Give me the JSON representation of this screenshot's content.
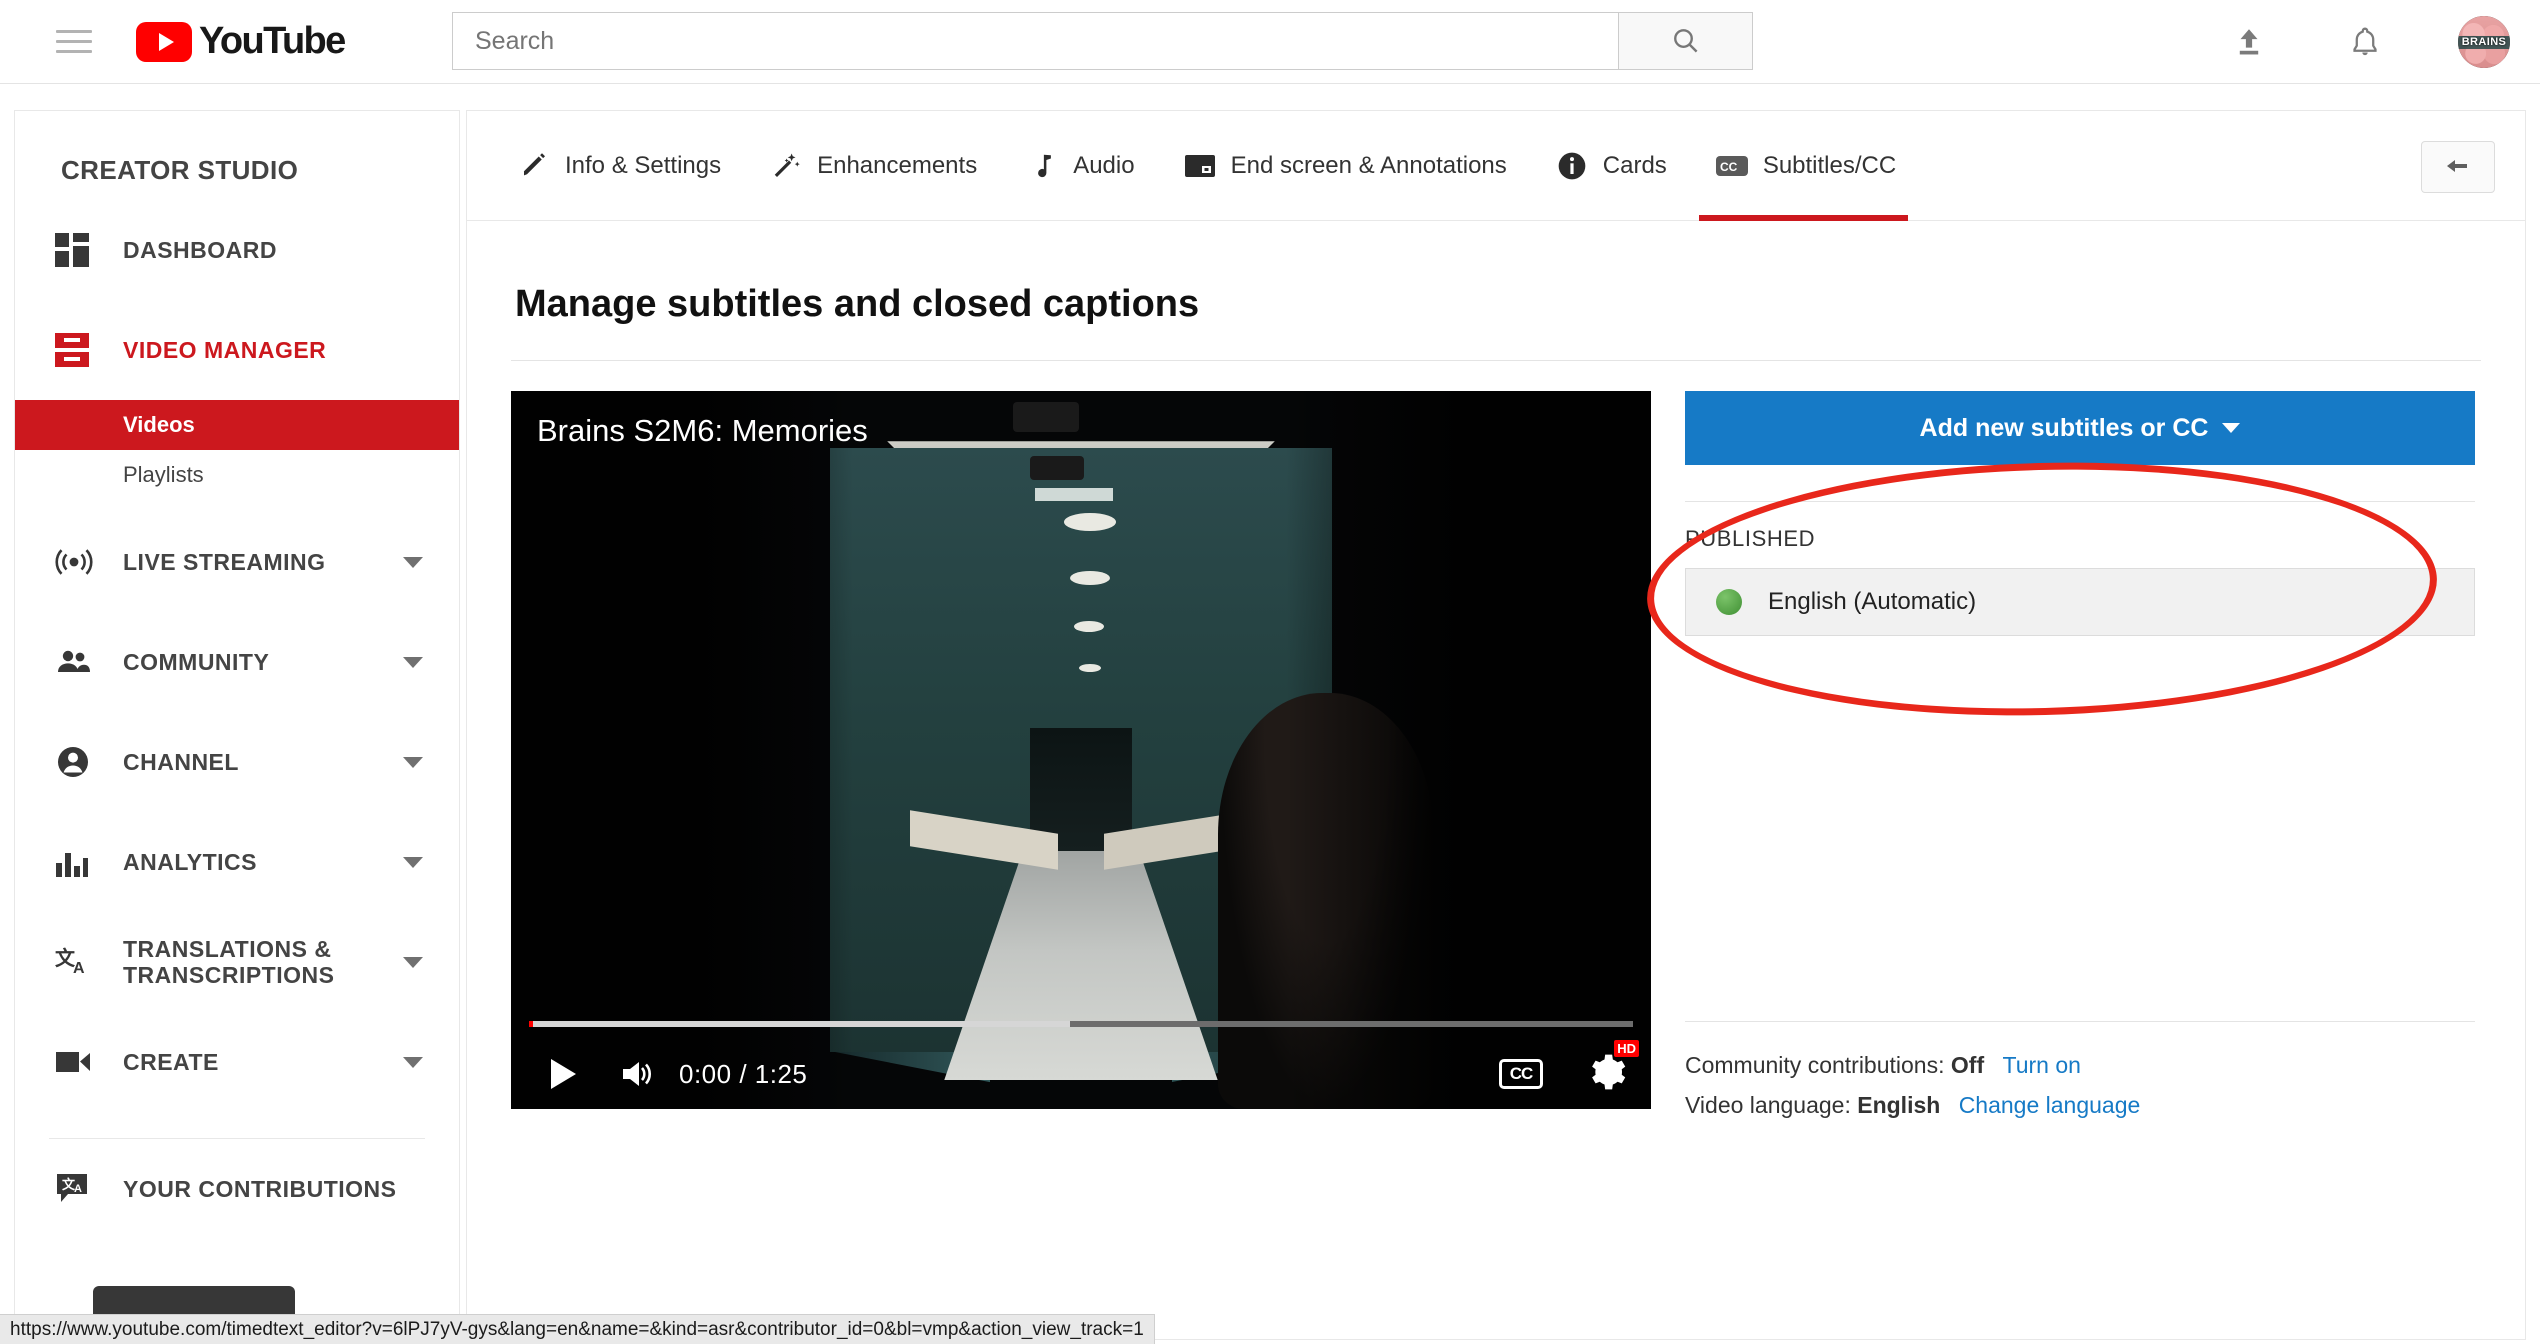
{
  "header": {
    "menu_icon": "hamburger-menu-icon",
    "logo_text": "YouTube",
    "search": {
      "placeholder": "Search",
      "value": "",
      "icon": "search-icon"
    },
    "upload_icon": "upload-icon",
    "notifications_icon": "bell-icon",
    "avatar_label": "BRAINS"
  },
  "sidebar": {
    "title": "CREATOR STUDIO",
    "items": [
      {
        "label": "DASHBOARD",
        "icon": "dashboard-icon",
        "expandable": false,
        "active": false
      },
      {
        "label": "VIDEO MANAGER",
        "icon": "video-manager-icon",
        "expandable": false,
        "active": true
      }
    ],
    "subitems": [
      {
        "label": "Videos",
        "selected": true
      },
      {
        "label": "Playlists",
        "selected": false
      }
    ],
    "items2": [
      {
        "label": "LIVE STREAMING",
        "icon": "live-streaming-icon",
        "expandable": true
      },
      {
        "label": "COMMUNITY",
        "icon": "people-icon",
        "expandable": true
      },
      {
        "label": "CHANNEL",
        "icon": "person-circle-icon",
        "expandable": true
      },
      {
        "label": "ANALYTICS",
        "icon": "bar-chart-icon",
        "expandable": true
      },
      {
        "label": "TRANSLATIONS & TRANSCRIPTIONS",
        "icon": "translate-icon",
        "expandable": true
      },
      {
        "label": "CREATE",
        "icon": "video-camera-icon",
        "expandable": true
      }
    ],
    "footer_items": [
      {
        "label": "YOUR CONTRIBUTIONS",
        "icon": "translate-bubble-icon"
      }
    ]
  },
  "tabs": [
    {
      "label": "Info & Settings",
      "icon": "pencil-icon",
      "active": false
    },
    {
      "label": "Enhancements",
      "icon": "magic-wand-icon",
      "active": false
    },
    {
      "label": "Audio",
      "icon": "music-note-icon",
      "active": false
    },
    {
      "label": "End screen & Annotations",
      "icon": "end-screen-icon",
      "active": false
    },
    {
      "label": "Cards",
      "icon": "info-circle-icon",
      "active": false
    },
    {
      "label": "Subtitles/CC",
      "icon": "closed-caption-icon",
      "active": true
    }
  ],
  "back_button_icon": "back-arrow-icon",
  "main": {
    "page_title": "Manage subtitles and closed captions"
  },
  "player": {
    "video_title": "Brains S2M6: Memories",
    "current_time": "0:00",
    "duration": "1:25",
    "time_display": "0:00 / 1:25",
    "play_icon": "play-icon",
    "volume_icon": "volume-icon",
    "cc_label": "CC",
    "quality_badge": "HD",
    "settings_icon": "gear-icon",
    "progress_percent": 0,
    "loaded_percent": 49
  },
  "right_panel": {
    "add_button_label": "Add new subtitles or CC",
    "add_button_color": "#167ac6",
    "published_label": "PUBLISHED",
    "tracks": [
      {
        "name": "English (Automatic)",
        "status_color": "#4a9e3b",
        "status": "published"
      }
    ],
    "community_contributions_label": "Community contributions:",
    "community_contributions_value": "Off",
    "community_contributions_action": "Turn on",
    "video_language_label": "Video language:",
    "video_language_value": "English",
    "video_language_action": "Change language"
  },
  "annotation": {
    "shape": "ellipse",
    "color": "#e8271b"
  },
  "status_bar": {
    "url": "https://www.youtube.com/timedtext_editor?v=6lPJ7yV-gys&lang=en&name=&kind=asr&contributor_id=0&bl=vmp&action_view_track=1"
  }
}
